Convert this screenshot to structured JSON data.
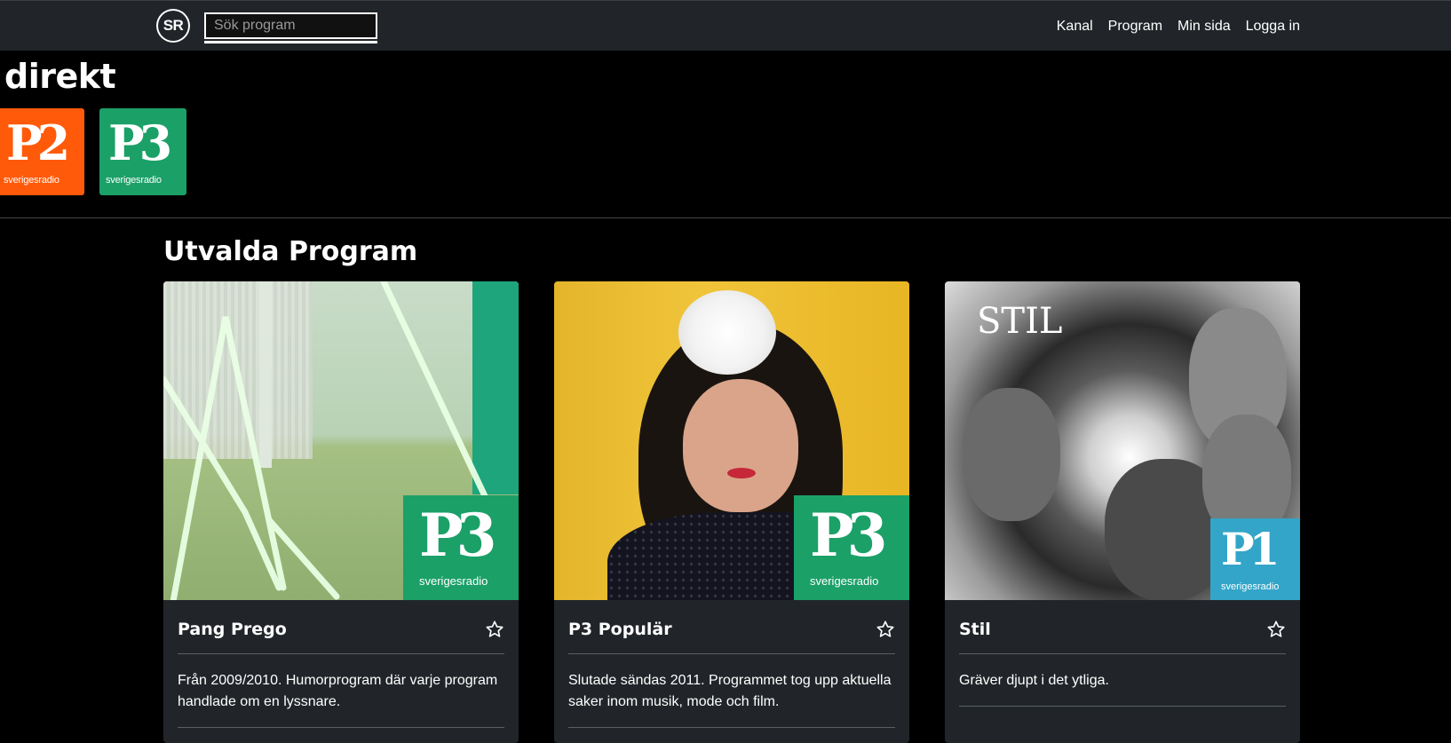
{
  "header": {
    "logo_text": "SR",
    "search_placeholder": "Sök program",
    "nav": [
      "Kanal",
      "Program",
      "Min sida",
      "Logga in"
    ]
  },
  "live": {
    "heading": "direkt",
    "channels": [
      {
        "big": "P2",
        "small": "sverigesradio",
        "color": "#ff5a0a"
      },
      {
        "big": "P3",
        "small": "sverigesradio",
        "color": "#1ba068"
      }
    ]
  },
  "featured": {
    "heading": "Utvalda Program",
    "programs": [
      {
        "title": "Pang Prego",
        "description": "Från 2009/2010. Humorprogram där varje program handlade om en lyssnare.",
        "badge": "P3",
        "badge_small": "sverigesradio"
      },
      {
        "title": "P3 Populär",
        "description": "Slutade sändas 2011. Programmet tog upp aktuella saker inom musik, mode och film.",
        "badge": "P3",
        "badge_small": "sverigesradio"
      },
      {
        "title": "Stil",
        "description": "Gräver djupt i det ytliga.",
        "badge": "P1",
        "badge_small": "sverigesradio",
        "image_text": "STIL"
      }
    ]
  },
  "colors": {
    "nav_bg": "#212529",
    "card_bg": "#212529",
    "p2": "#ff5a0a",
    "p3": "#1ba068",
    "p1": "#33a5c8"
  },
  "icons": {
    "favorite": "star-outline-icon"
  }
}
